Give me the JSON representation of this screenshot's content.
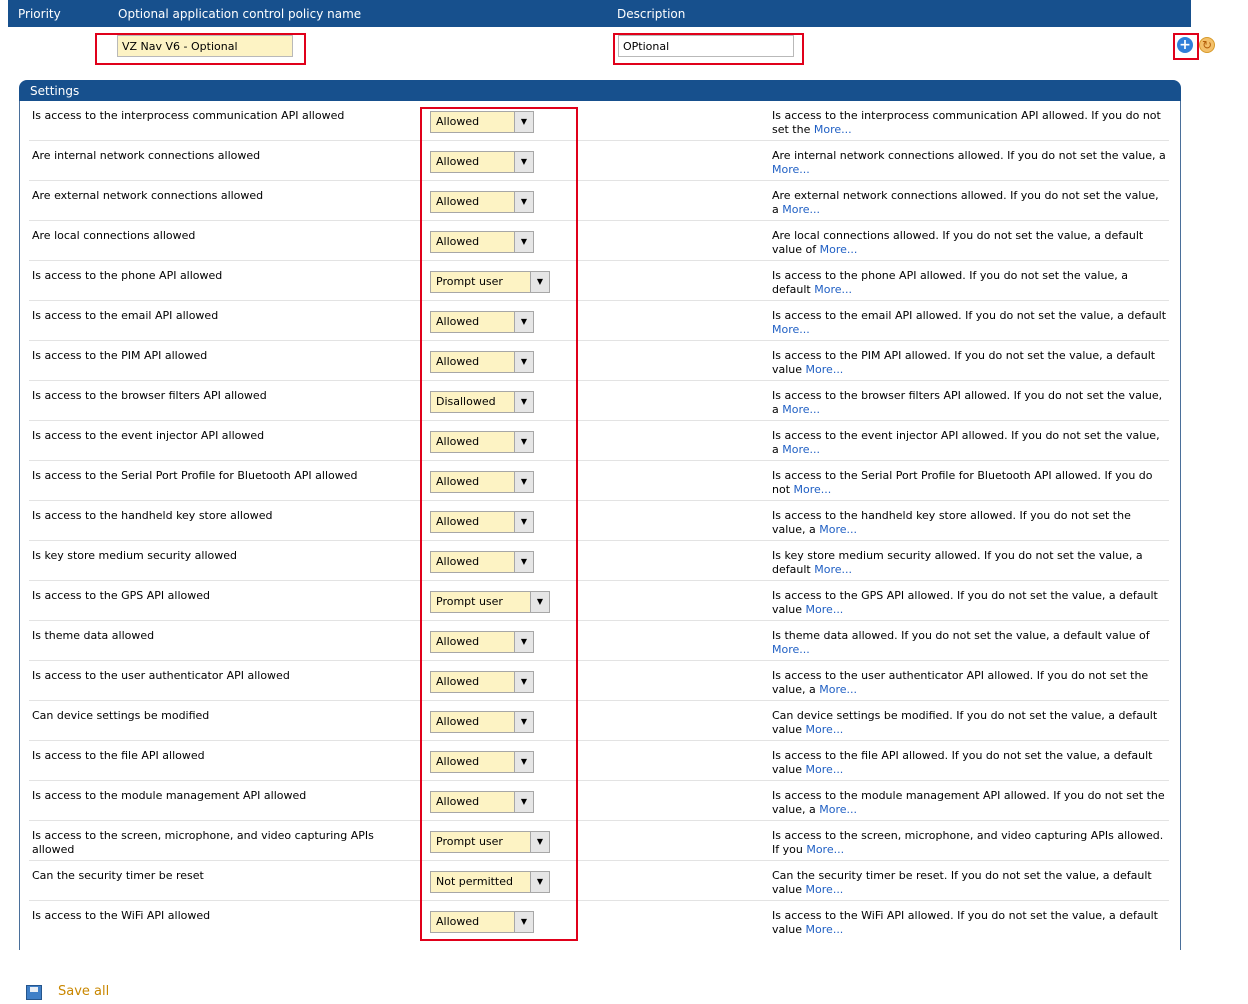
{
  "header": {
    "priority": "Priority",
    "name": "Optional application control policy name",
    "description": "Description"
  },
  "policy": {
    "name_value": "VZ Nav V6 - Optional",
    "description_value": "OPtional"
  },
  "icons": {
    "add": "plus-circle-icon",
    "refresh": "refresh-icon"
  },
  "settings_title": "Settings",
  "more_label": "More...",
  "rows": [
    {
      "label": "Is access to the interprocess communication API allowed",
      "value": "Allowed",
      "desc": "Is access to the interprocess communication API allowed. If you do not set the"
    },
    {
      "label": "Are internal network connections allowed",
      "value": "Allowed",
      "desc": "Are internal network connections allowed. If you do not set the value, a"
    },
    {
      "label": "Are external network connections allowed",
      "value": "Allowed",
      "desc": "Are external network connections allowed. If you do not set the value, a"
    },
    {
      "label": "Are local connections allowed",
      "value": "Allowed",
      "desc": "Are local connections allowed. If you do not set the value, a default value of"
    },
    {
      "label": "Is access to the phone API allowed",
      "value": "Prompt user",
      "desc": "Is access to the phone API allowed. If you do not set the value, a default"
    },
    {
      "label": "Is access to the email API allowed",
      "value": "Allowed",
      "desc": "Is access to the email API allowed. If you do not set the value, a default"
    },
    {
      "label": "Is access to the PIM API allowed",
      "value": "Allowed",
      "desc": "Is access to the PIM API allowed. If you do not set the value, a default value"
    },
    {
      "label": "Is access to the browser filters API allowed",
      "value": "Disallowed",
      "desc": "Is access to the browser filters API allowed. If you do not set the value, a"
    },
    {
      "label": "Is access to the event injector API allowed",
      "value": "Allowed",
      "desc": "Is access to the event injector API allowed. If you do not set the value, a"
    },
    {
      "label": "Is access to the Serial Port Profile for Bluetooth API allowed",
      "value": "Allowed",
      "desc": "Is access to the Serial Port Profile for Bluetooth API allowed. If you do not"
    },
    {
      "label": "Is access to the handheld key store allowed",
      "value": "Allowed",
      "desc": "Is access to the handheld key store allowed. If you do not set the value, a"
    },
    {
      "label": "Is key store medium security allowed",
      "value": "Allowed",
      "desc": "Is key store medium security allowed. If you do not set the value, a default"
    },
    {
      "label": "Is access to the GPS API allowed",
      "value": "Prompt user",
      "desc": "Is access to the GPS API allowed. If you do not set the value, a default value"
    },
    {
      "label": "Is theme data allowed",
      "value": "Allowed",
      "desc": "Is theme data allowed. If you do not set the value, a default value of"
    },
    {
      "label": "Is access to the user authenticator API allowed",
      "value": "Allowed",
      "desc": "Is access to the user authenticator API allowed. If you do not set the value, a"
    },
    {
      "label": "Can device settings be modified",
      "value": "Allowed",
      "desc": "Can device settings be modified. If you do not set the value, a default value"
    },
    {
      "label": "Is access to the file API allowed",
      "value": "Allowed",
      "desc": "Is access to the file API allowed. If you do not set the value, a default value"
    },
    {
      "label": "Is access to the module management API allowed",
      "value": "Allowed",
      "desc": "Is access to the module management API allowed. If you do not set the value, a"
    },
    {
      "label": "Is access to the screen, microphone, and video capturing APIs allowed",
      "value": "Prompt user",
      "desc": "Is access to the screen, microphone, and video capturing APIs allowed. If you"
    },
    {
      "label": "Can the security timer be reset",
      "value": "Not permitted",
      "desc": "Can the security timer be reset. If you do not set the value, a default value"
    },
    {
      "label": "Is access to the WiFi API allowed",
      "value": "Allowed",
      "desc": "Is access to the WiFi API allowed. If you do not set the value, a default value"
    }
  ],
  "save_label": "Save all"
}
